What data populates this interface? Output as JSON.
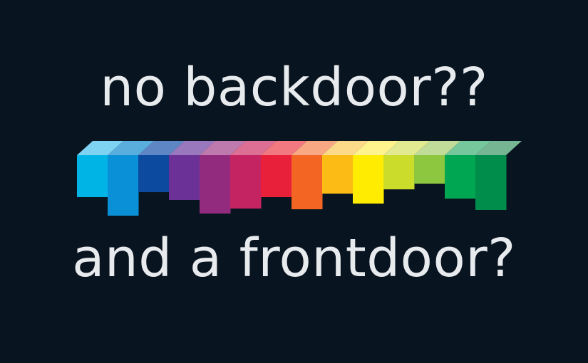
{
  "text": {
    "line_top": "no backdoor??",
    "line_bottom": "and a frontdoor?"
  },
  "colors": {
    "background": "#081420",
    "text": "#e8ebee"
  },
  "logo": {
    "icon": "rainbow-staircase-bars-icon",
    "bars": [
      {
        "front": "#00b4e6",
        "top": "#7fd3f2"
      },
      {
        "front": "#0a90d6",
        "top": "#5aaedd"
      },
      {
        "front": "#0c4aa0",
        "top": "#5f86c4"
      },
      {
        "front": "#6c3196",
        "top": "#9a78bd"
      },
      {
        "front": "#922b7e",
        "top": "#be79ad"
      },
      {
        "front": "#c42462",
        "top": "#dc6f93"
      },
      {
        "front": "#e9203a",
        "top": "#f1797f"
      },
      {
        "front": "#f36523",
        "top": "#f8a983"
      },
      {
        "front": "#fcbc15",
        "top": "#fdd98a"
      },
      {
        "front": "#ffec00",
        "top": "#fff38e"
      },
      {
        "front": "#cbdc2a",
        "top": "#e2ea91"
      },
      {
        "front": "#8dc63f",
        "top": "#c0dc98"
      },
      {
        "front": "#00a651",
        "top": "#76c79b"
      },
      {
        "front": "#008c4a",
        "top": "#76b693"
      }
    ]
  }
}
